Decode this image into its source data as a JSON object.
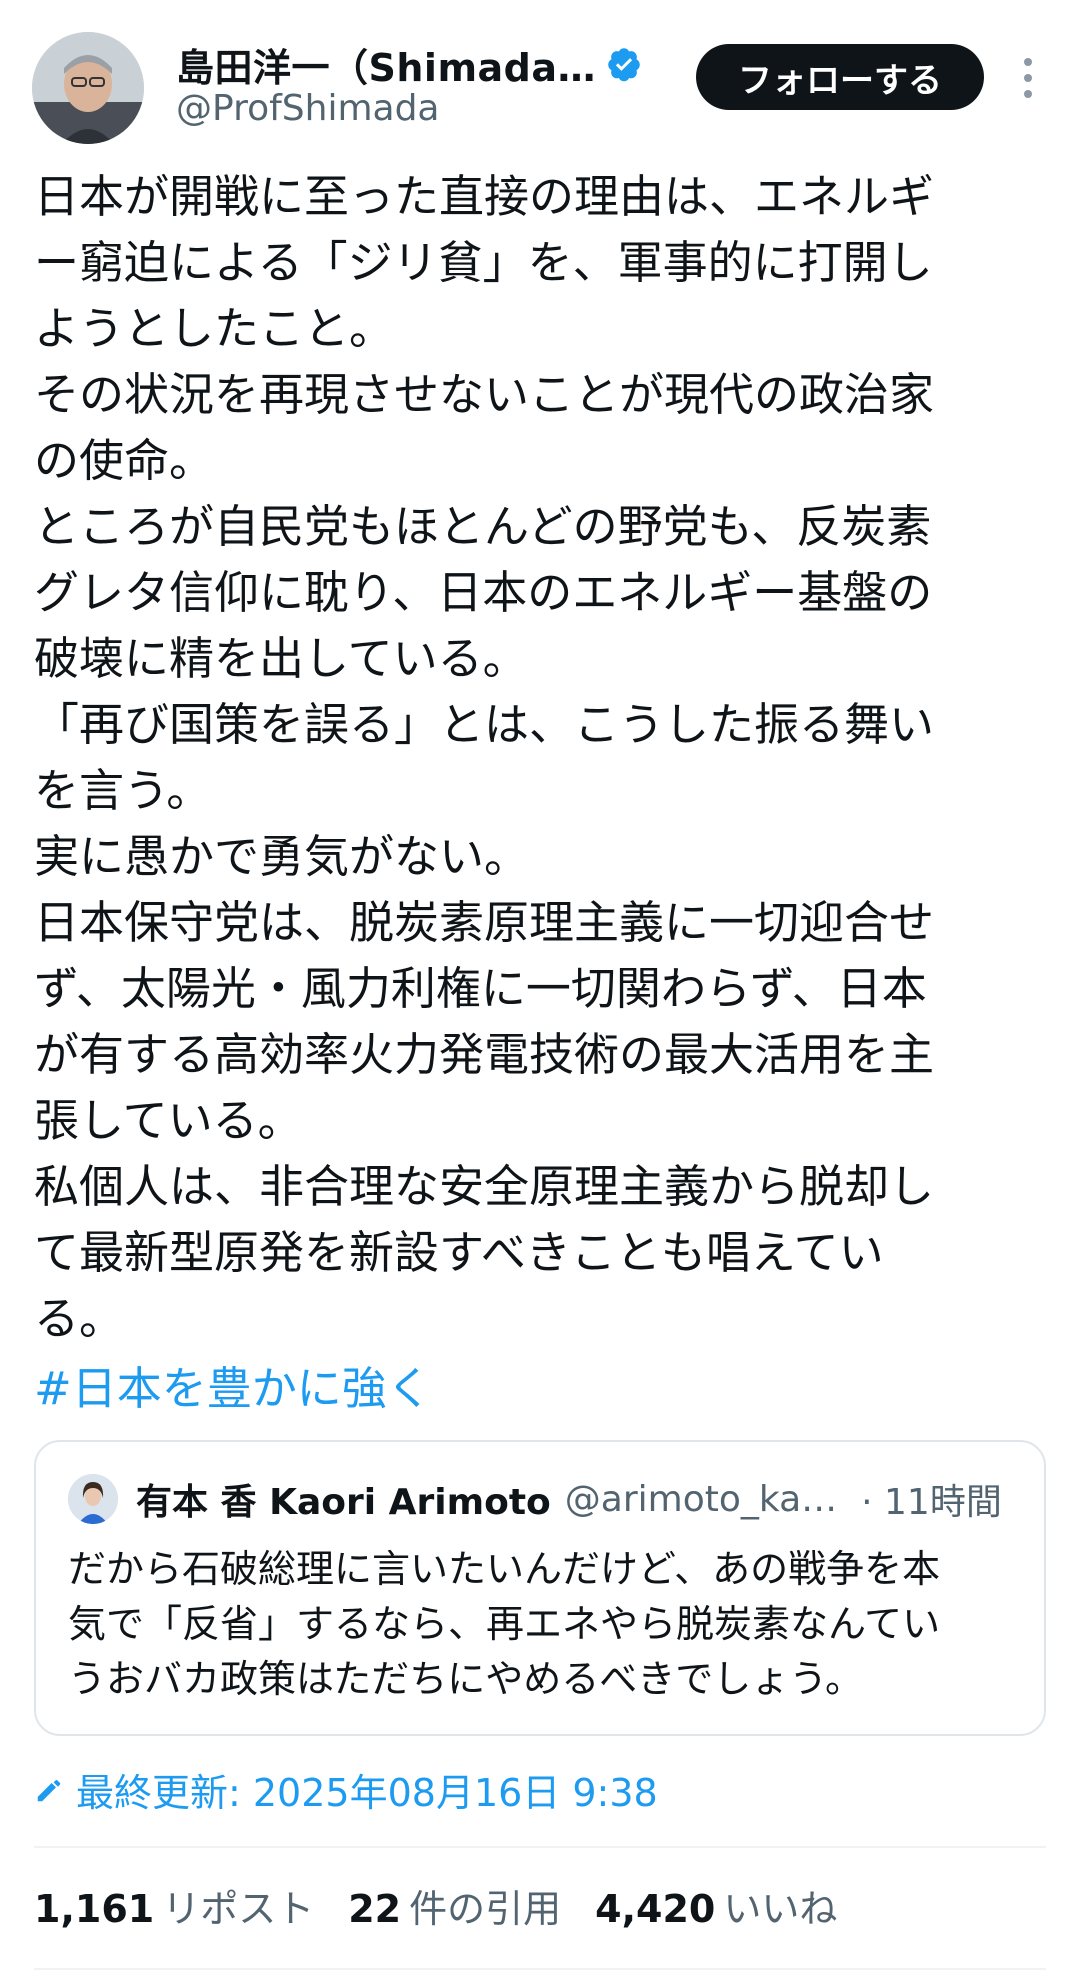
{
  "author": {
    "display_name": "島田洋一（Shimada…",
    "handle": "@ProfShimada",
    "follow_label": "フォローする"
  },
  "tweet": {
    "text": "日本が開戦に至った直接の理由は、エネルギ\nー窮迫による「ジリ貧」を、軍事的に打開し\nようとしたこと。\nその状況を再現させないことが現代の政治家\nの使命。\nところが自民党もほとんどの野党も、反炭素\nグレタ信仰に耽り、日本のエネルギー基盤の\n破壊に精を出している。\n「再び国策を誤る」とは、こうした振る舞い\nを言う。\n実に愚かで勇気がない。\n日本保守党は、脱炭素原理主義に一切迎合せ\nず、太陽光・風力利権に一切関わらず、日本\nが有する高効率火力発電技術の最大活用を主\n張している。\n私個人は、非合理な安全原理主義から脱却し\nて最新型原発を新設すべきことも唱えてい\nる。",
    "hashtag": "#日本を豊かに強く"
  },
  "quote": {
    "name": "有本 香 Kaori Arimoto",
    "handle": "@arimoto_ka…",
    "time": "· 11時間",
    "text": "だから石破総理に言いたいんだけど、あの戦争を本\n気で「反省」するなら、再エネやら脱炭素なんてい\nうおバカ政策はただちにやめるべきでしょう。"
  },
  "edited": {
    "label": "最終更新: 2025年08月16日 9:38",
    "icon": "pencil-icon"
  },
  "stats": {
    "reposts_count": "1,161",
    "reposts_label": "リポスト",
    "quotes_count": "22",
    "quotes_label": "件の引用",
    "likes_count": "4,420",
    "likes_label": "いいね"
  },
  "colors": {
    "accent": "#1d9bf0",
    "text": "#0f1419",
    "secondary": "#536471",
    "border": "#dfe5e9"
  }
}
